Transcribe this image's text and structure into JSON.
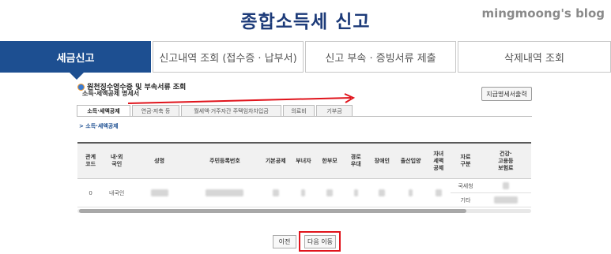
{
  "header": {
    "title": "종합소득세 신고",
    "watermark": "mingmoong's blog"
  },
  "main_tabs": [
    {
      "label": "세금신고",
      "active": true
    },
    {
      "label": "신고내역 조회 (접수증 · 납부서)",
      "active": false
    },
    {
      "label": "신고 부속 · 증빙서류 제출",
      "active": false
    },
    {
      "label": "삭제내역 조회",
      "active": false
    }
  ],
  "section": {
    "title": "원천징수영수증 및 부속서류 조회",
    "subtitle": "소득·세액공제 명세서",
    "print_button": "지급명세서출력"
  },
  "sub_tabs": [
    {
      "label": "소득·세액공제",
      "active": true
    },
    {
      "label": "연금·저축 등",
      "active": false
    },
    {
      "label": "월세액·거주자간 주택임차차입금",
      "active": false
    },
    {
      "label": "의료비",
      "active": false
    },
    {
      "label": "기부금",
      "active": false
    }
  ],
  "breadcrumb": "> 소득·세액공제",
  "table": {
    "headers": [
      "관계\n코드",
      "내·외\n국인",
      "성명",
      "주민등록번호",
      "기본공제",
      "부녀자",
      "한부모",
      "경로\n우대",
      "장애인",
      "출산입양",
      "자녀\n세액\n공제",
      "자료\n구분",
      "건강·\n고용등\n보험료"
    ],
    "row": {
      "rel_code": "0",
      "nationality": "내국인",
      "source_1": "국세청",
      "source_2": "기타"
    }
  },
  "buttons": {
    "prev": "이전",
    "next": "다음 이동"
  },
  "colors": {
    "primary": "#1d4f91",
    "highlight": "#e0141c"
  }
}
